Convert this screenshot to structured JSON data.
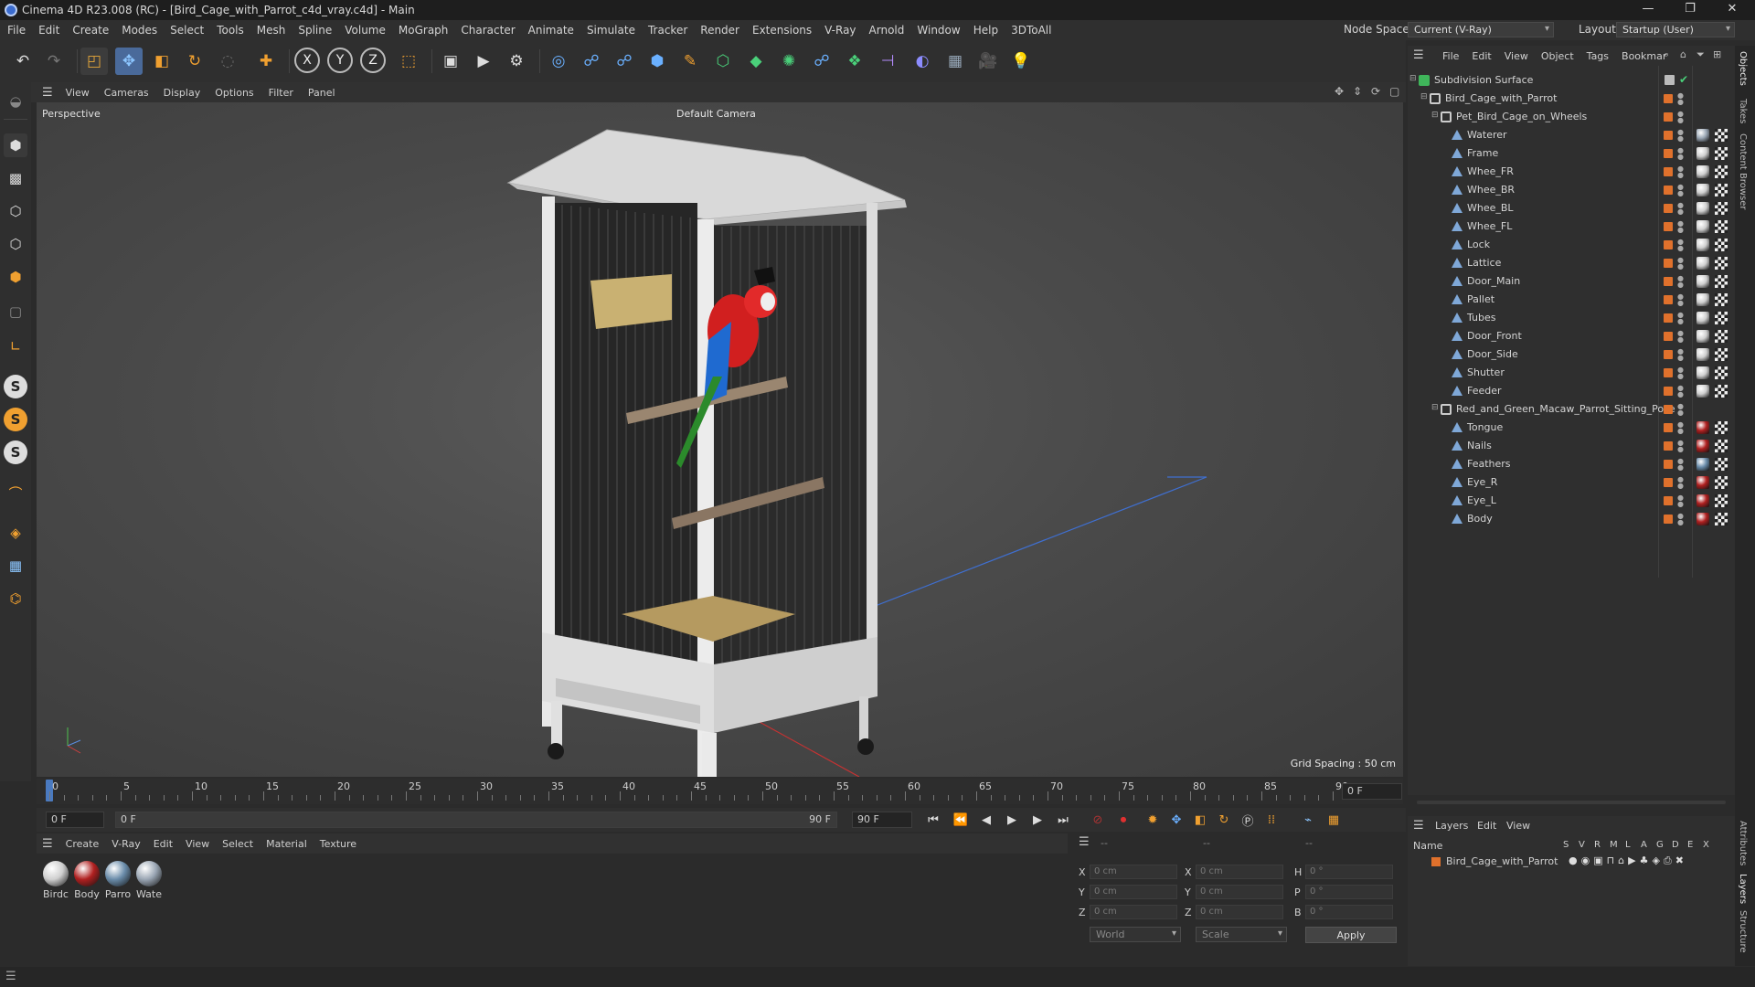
{
  "window": {
    "title": "Cinema 4D R23.008 (RC) - [Bird_Cage_with_Parrot_c4d_vray.c4d] - Main",
    "min": "—",
    "max": "❐",
    "close": "✕"
  },
  "menu": {
    "items": [
      "File",
      "Edit",
      "Create",
      "Modes",
      "Select",
      "Tools",
      "Mesh",
      "Spline",
      "Volume",
      "MoGraph",
      "Character",
      "Animate",
      "Simulate",
      "Tracker",
      "Render",
      "Extensions",
      "V-Ray",
      "Arnold",
      "Window",
      "Help",
      "3DToAll"
    ],
    "node_space_label": "Node Space:",
    "node_space_value": "Current (V-Ray)",
    "layout_label": "Layout:",
    "layout_value": "Startup (User)"
  },
  "viewport": {
    "menu": [
      "View",
      "Cameras",
      "Display",
      "Options",
      "Filter",
      "Panel"
    ],
    "label": "Perspective",
    "camera": "Default Camera",
    "grid_spacing": "Grid Spacing : 50 cm"
  },
  "timeline": {
    "ticks": [
      "0",
      "5",
      "10",
      "15",
      "20",
      "25",
      "30",
      "35",
      "40",
      "45",
      "50",
      "55",
      "60",
      "65",
      "70",
      "75",
      "80",
      "85",
      "90"
    ],
    "end_field": "0 F",
    "current_frame": "0 F",
    "range_start": "0 F",
    "range_end": "90 F",
    "max_frame": "90 F"
  },
  "materials": {
    "menu": [
      "Create",
      "V-Ray",
      "Edit",
      "View",
      "Select",
      "Material",
      "Texture"
    ],
    "items": [
      {
        "name": "Birdc",
        "color": "#cfcfcf"
      },
      {
        "name": "Body",
        "color": "#b02020"
      },
      {
        "name": "Parro",
        "color": "#6a8caa"
      },
      {
        "name": "Wate",
        "color": "#9aa6b4"
      }
    ]
  },
  "coords": {
    "header_a": "--",
    "header_b": "--",
    "header_c": "--",
    "x": "X",
    "y": "Y",
    "z": "Z",
    "h": "H",
    "p": "P",
    "b": "B",
    "x_val": "0 cm",
    "y_val": "0 cm",
    "z_val": "0 cm",
    "sx_val": "0 cm",
    "sy_val": "0 cm",
    "sz_val": "0 cm",
    "h_val": "0 °",
    "p_val": "0 °",
    "b_val": "0 °",
    "world": "World",
    "scale": "Scale",
    "apply": "Apply"
  },
  "objects": {
    "menu": [
      "File",
      "Edit",
      "View",
      "Object",
      "Tags",
      "Bookmar"
    ],
    "rows": [
      {
        "name": "Subdivision Surface",
        "indent": 0,
        "kind": "sds"
      },
      {
        "name": "Bird_Cage_with_Parrot",
        "indent": 1,
        "kind": "null"
      },
      {
        "name": "Pet_Bird_Cage_on_Wheels",
        "indent": 2,
        "kind": "null"
      },
      {
        "name": "Waterer",
        "indent": 3,
        "kind": "mesh",
        "mat": "#9aa6b4"
      },
      {
        "name": "Frame",
        "indent": 3,
        "kind": "mesh",
        "mat": "#cfcfcf"
      },
      {
        "name": "Whee_FR",
        "indent": 3,
        "kind": "mesh",
        "mat": "#cfcfcf"
      },
      {
        "name": "Whee_BR",
        "indent": 3,
        "kind": "mesh",
        "mat": "#cfcfcf"
      },
      {
        "name": "Whee_BL",
        "indent": 3,
        "kind": "mesh",
        "mat": "#cfcfcf"
      },
      {
        "name": "Whee_FL",
        "indent": 3,
        "kind": "mesh",
        "mat": "#cfcfcf"
      },
      {
        "name": "Lock",
        "indent": 3,
        "kind": "mesh",
        "mat": "#cfcfcf"
      },
      {
        "name": "Lattice",
        "indent": 3,
        "kind": "mesh",
        "mat": "#cfcfcf"
      },
      {
        "name": "Door_Main",
        "indent": 3,
        "kind": "mesh",
        "mat": "#cfcfcf"
      },
      {
        "name": "Pallet",
        "indent": 3,
        "kind": "mesh",
        "mat": "#cfcfcf"
      },
      {
        "name": "Tubes",
        "indent": 3,
        "kind": "mesh",
        "mat": "#cfcfcf"
      },
      {
        "name": "Door_Front",
        "indent": 3,
        "kind": "mesh",
        "mat": "#cfcfcf"
      },
      {
        "name": "Door_Side",
        "indent": 3,
        "kind": "mesh",
        "mat": "#cfcfcf"
      },
      {
        "name": "Shutter",
        "indent": 3,
        "kind": "mesh",
        "mat": "#cfcfcf"
      },
      {
        "name": "Feeder",
        "indent": 3,
        "kind": "mesh",
        "mat": "#cfcfcf"
      },
      {
        "name": "Red_and_Green_Macaw_Parrot_Sitting_Pose",
        "indent": 2,
        "kind": "null"
      },
      {
        "name": "Tongue",
        "indent": 3,
        "kind": "mesh",
        "mat": "#b02020"
      },
      {
        "name": "Nails",
        "indent": 3,
        "kind": "mesh",
        "mat": "#b02020"
      },
      {
        "name": "Feathers",
        "indent": 3,
        "kind": "mesh",
        "mat": "#6a8caa"
      },
      {
        "name": "Eye_R",
        "indent": 3,
        "kind": "mesh",
        "mat": "#b02020"
      },
      {
        "name": "Eye_L",
        "indent": 3,
        "kind": "mesh",
        "mat": "#b02020"
      },
      {
        "name": "Body",
        "indent": 3,
        "kind": "mesh",
        "mat": "#b02020"
      }
    ]
  },
  "layers": {
    "menu": [
      "Layers",
      "Edit",
      "View"
    ],
    "name_header": "Name",
    "cols": [
      "S",
      "V",
      "R",
      "M",
      "L",
      "A",
      "G",
      "D",
      "E",
      "X"
    ],
    "rows": [
      {
        "name": "Bird_Cage_with_Parrot",
        "color": "#e0712c"
      }
    ]
  },
  "side_tabs": [
    "Objects",
    "Takes",
    "Content Browser",
    "Attributes",
    "Layers",
    "Structure"
  ]
}
